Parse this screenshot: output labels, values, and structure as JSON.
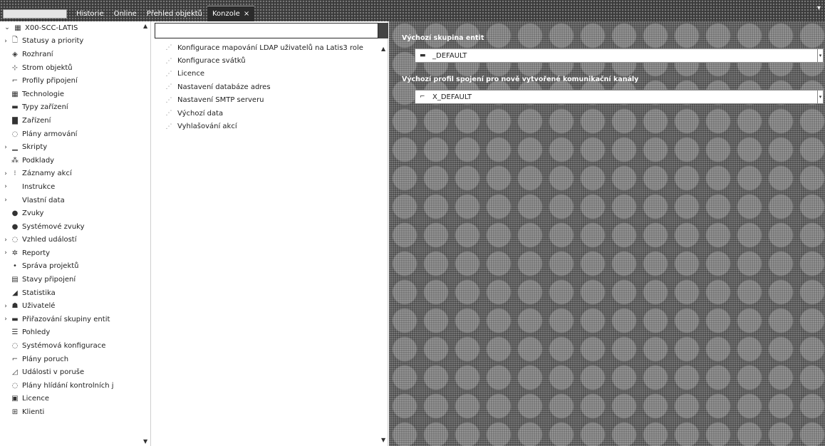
{
  "tabs": [
    {
      "label": "Historie"
    },
    {
      "label": "Online"
    },
    {
      "label": "Přehled objektů"
    },
    {
      "label": "Konzole",
      "close": "×"
    }
  ],
  "tree": {
    "root": "X00-SCC-LATIS",
    "items": [
      {
        "label": "Statusy a priority",
        "arrow": "›",
        "icon": "🗋"
      },
      {
        "label": "Rozhraní",
        "arrow": "",
        "icon": "◈"
      },
      {
        "label": "Strom objektů",
        "arrow": "",
        "icon": "⊹"
      },
      {
        "label": "Profily připojení",
        "arrow": "",
        "icon": "⌐"
      },
      {
        "label": "Technologie",
        "arrow": "",
        "icon": "▦"
      },
      {
        "label": "Typy zařízení",
        "arrow": "",
        "icon": "▬"
      },
      {
        "label": "Zařízení",
        "arrow": "",
        "icon": "▇"
      },
      {
        "label": "Plány armování",
        "arrow": "",
        "icon": "◌"
      },
      {
        "label": "Skripty",
        "arrow": "›",
        "icon": "▁"
      },
      {
        "label": "Podklady",
        "arrow": "",
        "icon": "⁂"
      },
      {
        "label": "Záznamy akcí",
        "arrow": "›",
        "icon": "⁝"
      },
      {
        "label": "Instrukce",
        "arrow": "›",
        "icon": ""
      },
      {
        "label": "Vlastní data",
        "arrow": "›",
        "icon": ""
      },
      {
        "label": "Zvuky",
        "arrow": "",
        "icon": "●"
      },
      {
        "label": "Systémové zvuky",
        "arrow": "",
        "icon": "●"
      },
      {
        "label": "Vzhled událostí",
        "arrow": "›",
        "icon": "◌"
      },
      {
        "label": "Reporty",
        "arrow": "›",
        "icon": "✲"
      },
      {
        "label": "Správa projektů",
        "arrow": "",
        "icon": "•"
      },
      {
        "label": "Stavy připojení",
        "arrow": "",
        "icon": "▤"
      },
      {
        "label": "Statistika",
        "arrow": "",
        "icon": "◢"
      },
      {
        "label": "Uživatelé",
        "arrow": "›",
        "icon": "☗"
      },
      {
        "label": "Přiřazování skupiny entit",
        "arrow": "›",
        "icon": "▬"
      },
      {
        "label": "Pohledy",
        "arrow": "",
        "icon": "☰"
      },
      {
        "label": "Systémová konfigurace",
        "arrow": "",
        "icon": "◌"
      },
      {
        "label": "Plány poruch",
        "arrow": "",
        "icon": "⌐"
      },
      {
        "label": "Události v poruše",
        "arrow": "",
        "icon": "◿"
      },
      {
        "label": "Plány hlídání kontrolních j",
        "arrow": "",
        "icon": "◌"
      },
      {
        "label": "Licence",
        "arrow": "",
        "icon": "▣"
      },
      {
        "label": "Klienti",
        "arrow": "",
        "icon": "⊞"
      }
    ]
  },
  "middle": {
    "search_value": "",
    "items": [
      {
        "label": "Konfigurace mapování LDAP uživatelů na Latis3 role"
      },
      {
        "label": "Konfigurace svátků"
      },
      {
        "label": "Licence"
      },
      {
        "label": "Nastavení databáze adres"
      },
      {
        "label": "Nastavení SMTP serveru"
      },
      {
        "label": "Výchozí data"
      },
      {
        "label": "Vyhlašování akcí"
      }
    ]
  },
  "right": {
    "group_label": "Výchozí skupina entit",
    "group_value": "_DEFAULT",
    "profile_label": "Výchozí profil spojení pro nově vytvořené komunikační kanály",
    "profile_value": "X_DEFAULT"
  }
}
